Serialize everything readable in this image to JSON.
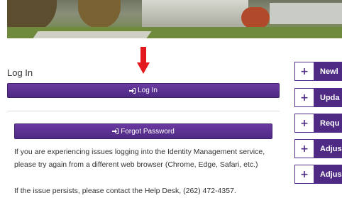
{
  "login": {
    "title": "Log In",
    "button_label": "Log In",
    "forgot_label": "Forgot Password"
  },
  "icons": {
    "login_icon": "sign-in-icon",
    "arrow_icon": "arrow-down-icon"
  },
  "colors": {
    "accent": "#4e2a84",
    "arrow": "#e3191f"
  },
  "info": {
    "issues_text": "If you are experiencing issues logging into the Identity Management service, please try again from a different web browser (Chrome, Edge, Safari, etc.)",
    "help_text": "If the issue persists, please contact the Help Desk, (262) 472-4357."
  },
  "sidebar": {
    "items": [
      {
        "plus": "+",
        "label": "Newl"
      },
      {
        "plus": "+",
        "label": "Upda"
      },
      {
        "plus": "+",
        "label": "Requ"
      },
      {
        "plus": "+",
        "label": "Adjus"
      },
      {
        "plus": "+",
        "label": "Adjus"
      }
    ]
  }
}
